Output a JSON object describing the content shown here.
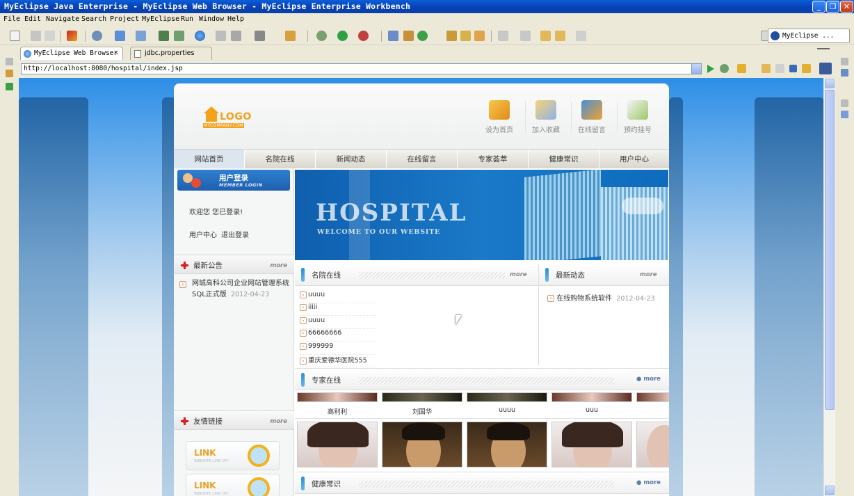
{
  "window": {
    "title": "MyEclipse Java Enterprise - MyEclipse Web Browser - MyEclipse Enterprise Workbench",
    "minimize": "_",
    "maximize": "❐",
    "close": "✕"
  },
  "menu": [
    "File",
    "Edit",
    "Navigate",
    "Search",
    "Project",
    "MyEclipse",
    "Run",
    "Window",
    "Help"
  ],
  "perspective": "MyEclipse ...",
  "tabs": [
    {
      "label": "MyEclipse Web Browser",
      "close": "✕"
    },
    {
      "label": "jdbc.properties"
    }
  ],
  "address": {
    "url": "http://localhost:8080/hospital/index.jsp"
  },
  "site": {
    "logo": {
      "main": "LOGO",
      "sub": "MYCOMPANY.COM"
    },
    "header_links": [
      "设为首页",
      "加入收藏",
      "在线留言",
      "预约挂号"
    ],
    "nav": [
      "网站首页",
      "名院在线",
      "新闻动态",
      "在线留言",
      "专家荟萃",
      "健康常识",
      "用户中心"
    ],
    "login": {
      "title": "用户登录",
      "subtitle": "MEMBER LOGIN",
      "welcome": "欢迎您  您已登录!",
      "user_center": "用户中心",
      "logout": "退出登录"
    },
    "notice": {
      "title": "最新公告",
      "more": "more",
      "items": [
        {
          "text": "网城高科公司企业网站管理系统SQL正式版",
          "date": "2012-04-23"
        }
      ]
    },
    "links_section": {
      "title": "友情链接",
      "more": "more",
      "link_text": "LINK",
      "link_sub": "WEBSITE LINK DIY"
    },
    "banner": {
      "title": "HOSPITAL",
      "subtitle": "WELCOME TO OUR WEBSITE"
    },
    "hospitals": {
      "title": "名院在线",
      "more": "more",
      "items": [
        "uuuu",
        "iiiii",
        "uuuu",
        "66666666",
        "999999",
        "重庆爱德华医院555"
      ]
    },
    "news": {
      "title": "最新动态",
      "more": "more",
      "items": [
        {
          "text": "在线购物系统软件",
          "date": "2012-04-23"
        }
      ]
    },
    "experts": {
      "title": "专家在线",
      "more": "more",
      "names": [
        "高利利",
        "刘国华",
        "uuuu",
        "uuu"
      ]
    },
    "health": {
      "title": "健康常识",
      "more": "more"
    }
  },
  "colors": {
    "titlebar": "#0842b8",
    "accent_blue": "#2e8ed6",
    "logo_orange": "#f4a11c",
    "nav_text": "#333333"
  }
}
